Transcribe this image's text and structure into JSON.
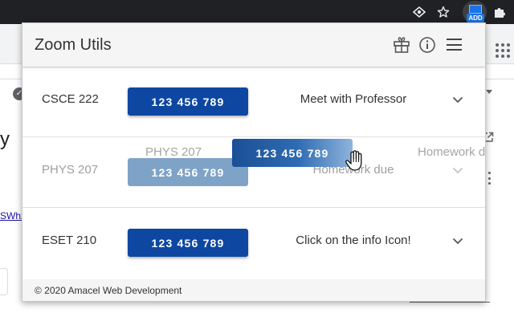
{
  "browser": {
    "extension_badge": "ADD"
  },
  "background": {
    "heading_fragment": "y",
    "link_fragment": "SWhz"
  },
  "popup": {
    "title": "Zoom Utils",
    "header_icons": [
      "gift-icon",
      "info-icon",
      "menu-icon"
    ],
    "rows": [
      {
        "course": "CSCE 222",
        "meeting_id": "123 456 789",
        "note": "Meet with Professor"
      },
      {
        "course": "PHYS 207",
        "meeting_id": "123 456 789",
        "note": "Homework due"
      },
      {
        "course": "ESET 210",
        "meeting_id": "123 456 789",
        "note": "Click on the info Icon!"
      }
    ],
    "dragged_row": {
      "course": "PHYS 207",
      "meeting_id": "123 456 789",
      "note": "Homework due"
    },
    "footer": "© 2020 Amacel Web Development"
  },
  "colors": {
    "button_blue": "#0d47a1",
    "chrome_dark": "#202124",
    "header_gray": "#f5f5f5"
  }
}
